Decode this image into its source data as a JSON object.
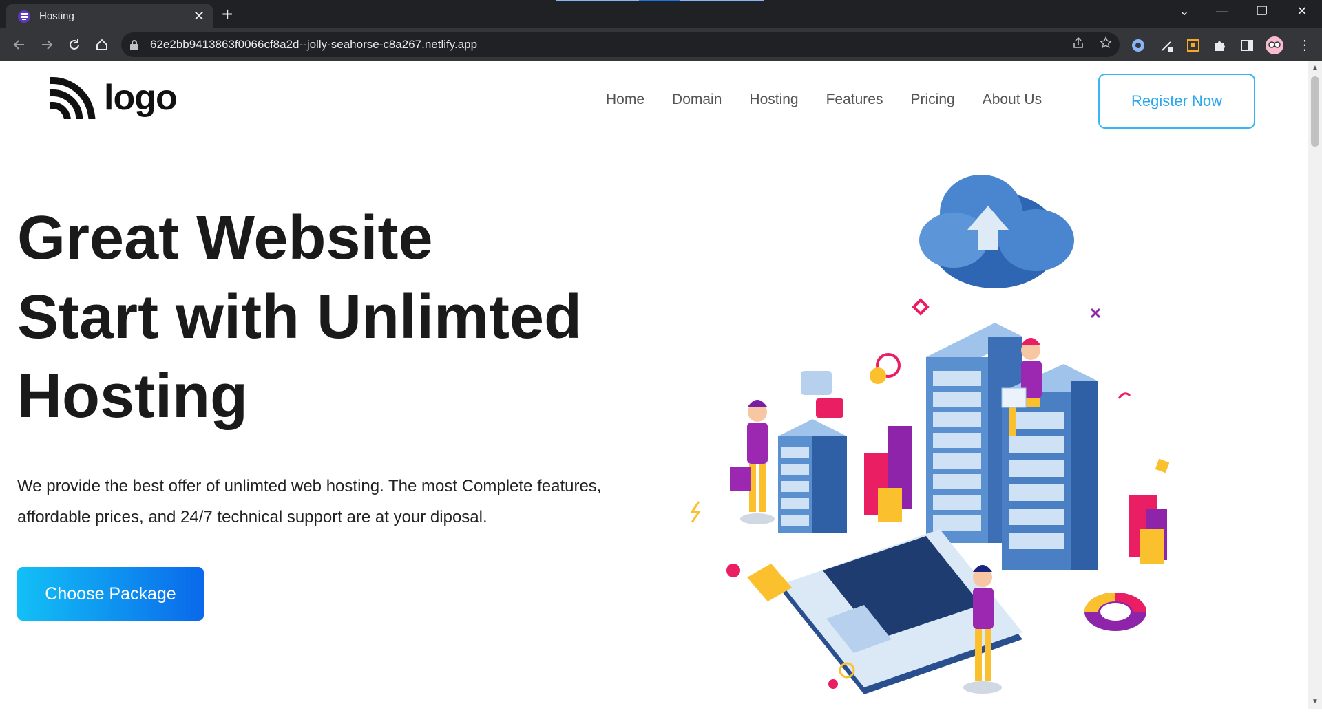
{
  "browser": {
    "tab_title": "Hosting",
    "tab_close": "✕",
    "new_tab": "+",
    "url": "62e2bb9413863f0066cf8a2d--jolly-seahorse-c8a267.netlify.app",
    "window": {
      "minimize": "—",
      "restore": "❐",
      "close": "✕",
      "tab_search": "⌄"
    }
  },
  "header": {
    "logo_text": "logo",
    "nav": [
      "Home",
      "Domain",
      "Hosting",
      "Features",
      "Pricing",
      "About Us"
    ],
    "register_label": "Register Now"
  },
  "hero": {
    "title_lines": [
      "Great Website",
      "Start with Unlimted",
      "Hosting"
    ],
    "description": "We provide the best offer of unlimted web hosting. The most Complete features, affordable prices, and 24/7 technical support are at your diposal.",
    "cta_label": "Choose Package"
  },
  "icons": {
    "back": "arrow-left-icon",
    "forward": "arrow-right-icon",
    "reload": "reload-icon",
    "home": "home-icon",
    "share": "share-icon",
    "bookmark": "star-icon",
    "sidebar": "sidebar-icon",
    "extensions": "puzzle-icon"
  },
  "colors": {
    "accent": "#2aa8ee",
    "cta_gradient_start": "#13c0f6",
    "cta_gradient_end": "#0a69ea",
    "chrome_dark": "#202124",
    "chrome_toolbar": "#35363a"
  }
}
